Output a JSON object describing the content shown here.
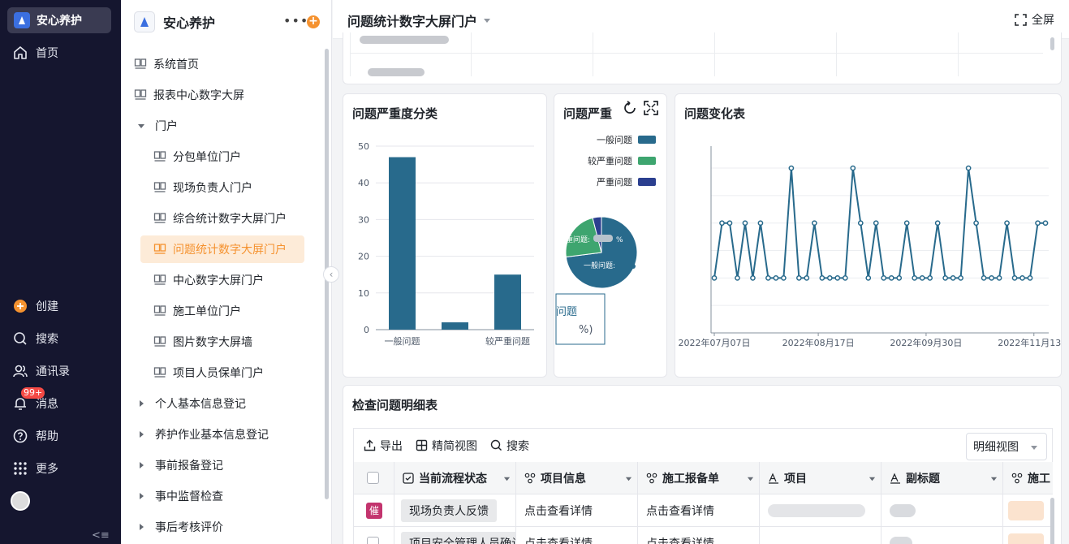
{
  "rail": {
    "app_name": "安心养护",
    "items": [
      {
        "label": "首页",
        "icon": "home-icon"
      },
      {
        "label": "创建",
        "icon": "plus-circle-icon"
      },
      {
        "label": "搜索",
        "icon": "search-icon"
      },
      {
        "label": "通讯录",
        "icon": "contacts-icon"
      },
      {
        "label": "消息",
        "icon": "bell-icon"
      },
      {
        "label": "帮助",
        "icon": "help-icon"
      },
      {
        "label": "更多",
        "icon": "grid-icon"
      }
    ],
    "message_badge": "99+"
  },
  "nav": {
    "title": "安心养护",
    "items": [
      {
        "label": "系统首页"
      },
      {
        "label": "报表中心数字大屏"
      },
      {
        "label": "门户"
      },
      {
        "label": "分包单位门户"
      },
      {
        "label": "现场负责人门户"
      },
      {
        "label": "综合统计数字大屏门户"
      },
      {
        "label": "问题统计数字大屏门户"
      },
      {
        "label": "中心数字大屏门户"
      },
      {
        "label": "施工单位门户"
      },
      {
        "label": "图片数字大屏墙"
      },
      {
        "label": "项目人员保单门户"
      },
      {
        "label": "个人基本信息登记"
      },
      {
        "label": "养护作业基本信息登记"
      },
      {
        "label": "事前报备登记"
      },
      {
        "label": "事中监督检查"
      },
      {
        "label": "事后考核评价"
      }
    ]
  },
  "header": {
    "title": "问题统计数字大屏门户",
    "fullscreen_label": "全屏"
  },
  "charts": {
    "severity_title": "问题严重度分类",
    "pie_title": "问题严重",
    "pie_legend": [
      "一般问题",
      "较严重问题",
      "严重问题"
    ],
    "pie_slice_label_1": "一般问题: ",
    "pie_slice_label_2": "重问题: ",
    "pie_slice_label_pct": "%",
    "pie_tooltip_1": "问题",
    "pie_tooltip_2": "%)",
    "trend_title": "问题变化表"
  },
  "chart_data": [
    {
      "type": "bar",
      "title": "问题严重度分类",
      "categories": [
        "一般问题",
        "",
        "较严重问题"
      ],
      "values": [
        47,
        2,
        15
      ],
      "ylim": [
        0,
        50
      ],
      "yticks": [
        "0",
        "10",
        "20",
        "30",
        "40",
        "50"
      ],
      "bar_color": "#286a8c",
      "grid": true
    },
    {
      "type": "pie",
      "title": "问题严重",
      "labels": [
        "一般问题",
        "较严重问题",
        "严重问题"
      ],
      "values": [
        73,
        23,
        4
      ],
      "colors": [
        "#286a8c",
        "#3ea56f",
        "#2b3f8f"
      ]
    },
    {
      "type": "line",
      "title": "问题变化表",
      "xticks": [
        "2022年07月07日",
        "2022年08月17日",
        "2022年09月30日",
        "2022年11月13日"
      ],
      "y": [
        2,
        4,
        4,
        2,
        4,
        2,
        4,
        2,
        2,
        2,
        6,
        2,
        2,
        4,
        2,
        2,
        2,
        2,
        6,
        4,
        2,
        4,
        2,
        2,
        2,
        4,
        2,
        2,
        2,
        4,
        2,
        2,
        2,
        6,
        4,
        2,
        2,
        2,
        4,
        2,
        2,
        2,
        4,
        4
      ],
      "ylim": [
        0,
        6.8
      ],
      "line_color": "#286a8c",
      "grid": true
    }
  ],
  "detail": {
    "title": "检查问题明细表",
    "toolbar": [
      "导出",
      "精简视图",
      "搜索"
    ],
    "view_mode": "明细视图",
    "columns": [
      "当前流程状态",
      "项目信息",
      "施工报备单",
      "项目",
      "副标题",
      "施工"
    ],
    "rows": [
      {
        "urge": "催",
        "status": "现场负责人反馈",
        "project_info": "点击查看详情",
        "report": "点击查看详情"
      },
      {
        "urge": "",
        "status": "项目安全管理人员确认",
        "project_info": "点击查看详情",
        "report": "点击查看详情"
      }
    ]
  },
  "colors": {
    "accent": "#f5922f",
    "rail_bg": "#15162f",
    "chart_primary": "#286a8c"
  }
}
